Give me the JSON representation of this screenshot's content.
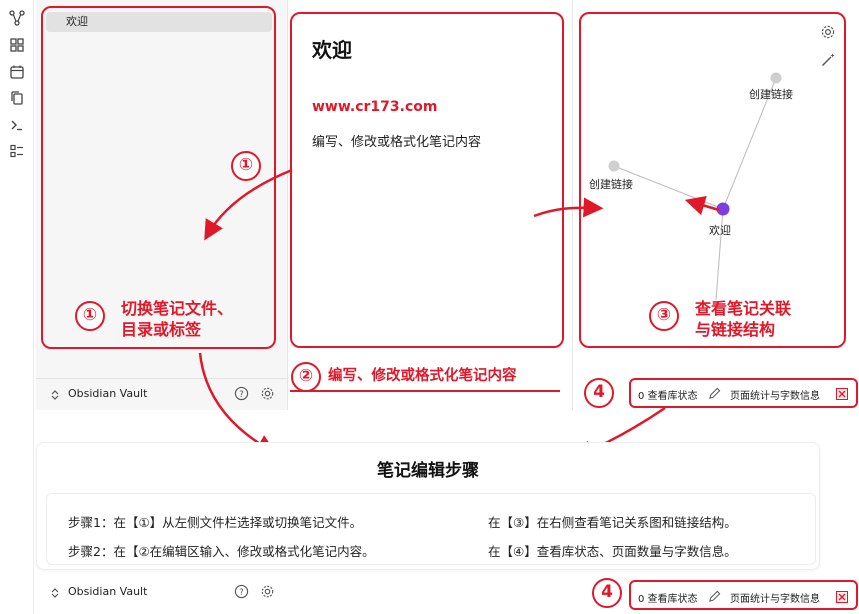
{
  "rail": {
    "icons": [
      "graph-icon",
      "grid-icon",
      "calendar-icon",
      "copy-icon",
      "terminal-icon",
      "list-icon"
    ]
  },
  "file_pane": {
    "item": "欢迎",
    "vault_name": "Obsidian Vault"
  },
  "editor": {
    "title": "欢迎",
    "url": "www.cr173.com",
    "body": "编写、修改或格式化笔记内容"
  },
  "graph": {
    "nodes": [
      "创建链接",
      "创建链接",
      "欢迎"
    ],
    "active_color": "#7b3fe4"
  },
  "status_bar": {
    "backlinks": "0 查看库状态",
    "word_info": "页面统计与字数信息"
  },
  "annotations": {
    "num1": "①",
    "num2": "②",
    "num3": "③",
    "num4": "4",
    "label1_line1": "切换笔记文件、",
    "label1_line2": "目录或标签",
    "label2": "编写、修改或格式化笔记内容",
    "label3_line1": "查看笔记关联",
    "label3_line2": "与链接结构",
    "accent": "#e0192a"
  },
  "steps": {
    "title": "笔记编辑步骤",
    "step1": "步骤1：在【①】从左侧文件栏选择或切换笔记文件。",
    "step2": "步骤2：在【②在编辑区输入、修改或格式化笔记内容。",
    "step3": "在【③】在右侧查看笔记关系图和链接结构。",
    "step4": "在【④】查看库状态、页面数量与字数信息。"
  }
}
